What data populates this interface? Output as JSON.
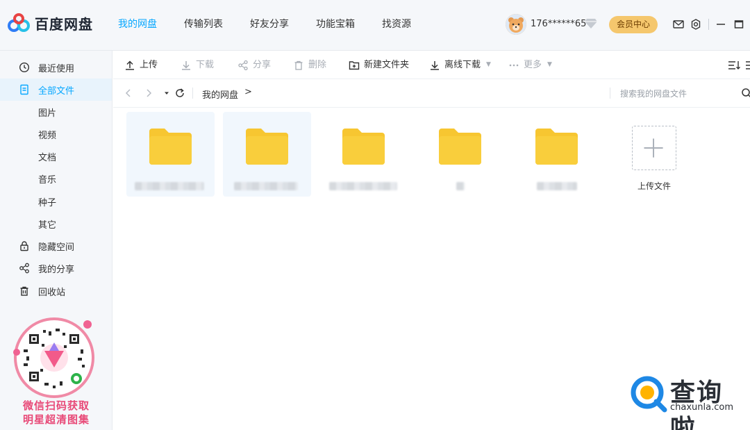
{
  "app": {
    "name": "百度网盘"
  },
  "topnav": {
    "items": [
      {
        "label": "我的网盘",
        "active": true
      },
      {
        "label": "传输列表"
      },
      {
        "label": "好友分享"
      },
      {
        "label": "功能宝箱"
      },
      {
        "label": "找资源"
      }
    ]
  },
  "user": {
    "name": "176******65",
    "vip_label": "会员中心"
  },
  "sidebar": {
    "items": [
      {
        "label": "最近使用",
        "icon": "clock-icon"
      },
      {
        "label": "全部文件",
        "icon": "document-icon",
        "active": true
      },
      {
        "label": "图片"
      },
      {
        "label": "视频"
      },
      {
        "label": "文档"
      },
      {
        "label": "音乐"
      },
      {
        "label": "种子"
      },
      {
        "label": "其它"
      },
      {
        "label": "隐藏空间",
        "icon": "lock-icon"
      },
      {
        "label": "我的分享",
        "icon": "share-icon"
      },
      {
        "label": "回收站",
        "icon": "trash-icon"
      }
    ]
  },
  "promo": {
    "line1": "微信扫码获取",
    "line2": "明星超清图集"
  },
  "toolbar": {
    "upload": "上传",
    "download": "下载",
    "share": "分享",
    "delete": "删除",
    "new_folder": "新建文件夹",
    "offline_download": "离线下载",
    "more": "更多"
  },
  "pathbar": {
    "crumb": "我的网盘",
    "crumb_sep": ">",
    "search_placeholder": "搜索我的网盘文件"
  },
  "files": {
    "upload_label": "上传文件"
  },
  "watermark": {
    "cn": "查询啦",
    "en": "chaxunla.com"
  },
  "colors": {
    "accent": "#06a7ff",
    "folder": "#f7c631",
    "vip": "#f5c76d",
    "promo": "#e84a78"
  }
}
